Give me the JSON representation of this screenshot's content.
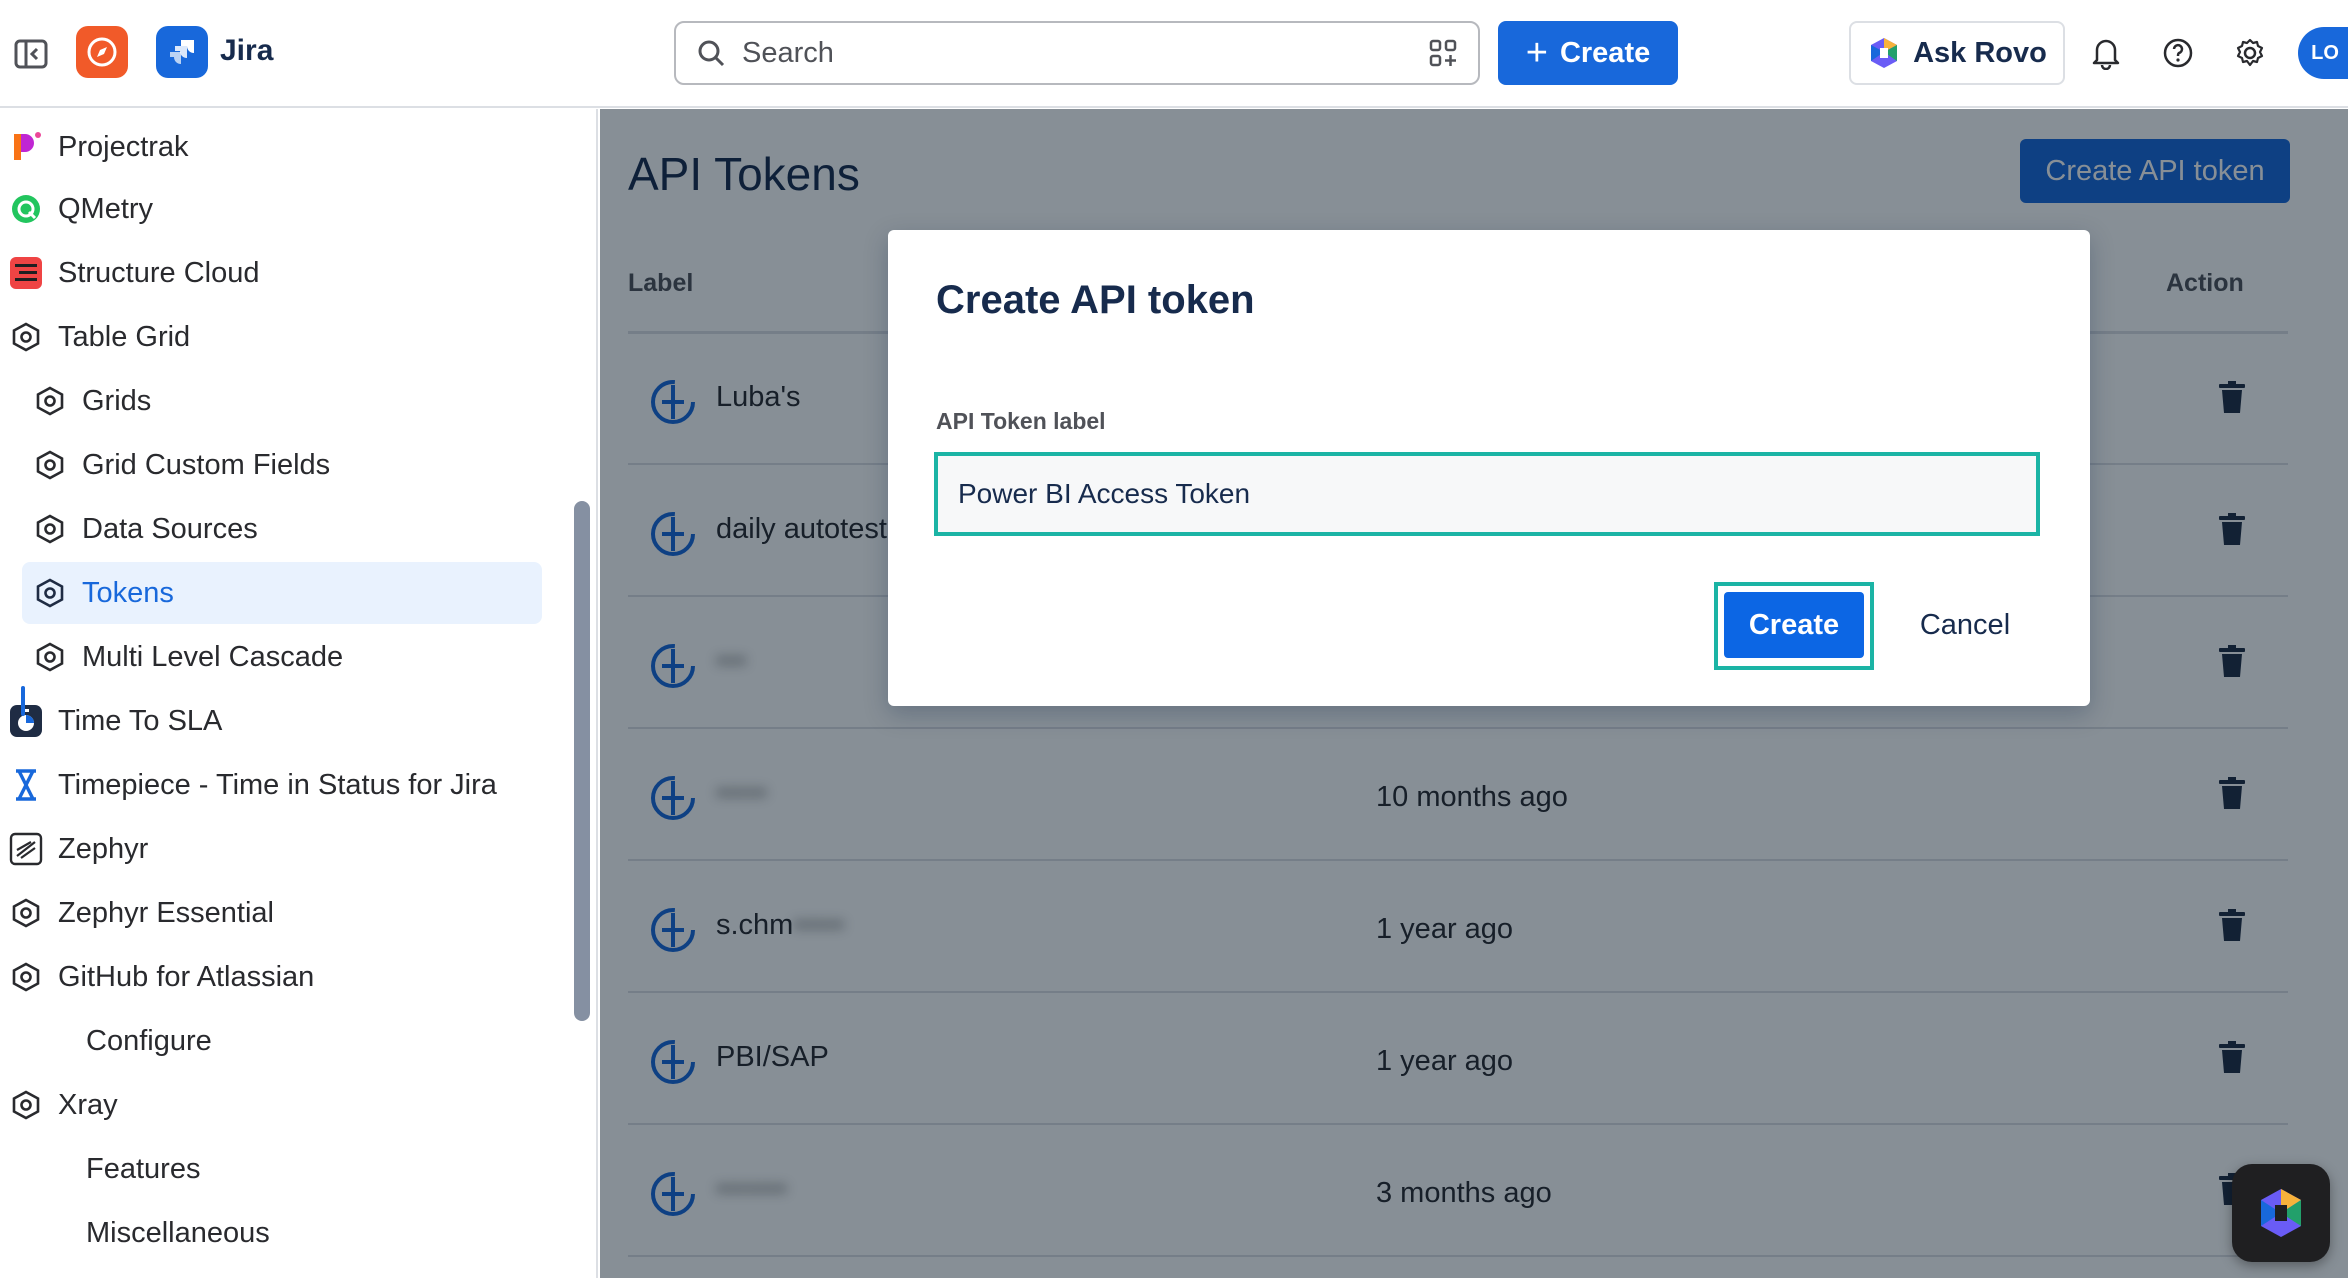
{
  "topbar": {
    "app_name": "Jira",
    "search_placeholder": "Search",
    "create_label": "Create",
    "ask_rovo_label": "Ask Rovo",
    "avatar_initials": "LO"
  },
  "sidebar": {
    "items": [
      {
        "label": "Projectrak",
        "icon": "projectrak-icon"
      },
      {
        "label": "QMetry",
        "icon": "qmetry-icon"
      },
      {
        "label": "Structure Cloud",
        "icon": "structure-icon"
      },
      {
        "label": "Table Grid",
        "icon": "hexagon-icon"
      },
      {
        "label": "Grids",
        "icon": "hexagon-icon"
      },
      {
        "label": "Grid Custom Fields",
        "icon": "hexagon-icon"
      },
      {
        "label": "Data Sources",
        "icon": "hexagon-icon"
      },
      {
        "label": "Tokens",
        "icon": "hexagon-icon",
        "active": true
      },
      {
        "label": "Multi Level Cascade",
        "icon": "hexagon-icon"
      },
      {
        "label": "Time To SLA",
        "icon": "time-to-sla-icon"
      },
      {
        "label": "Timepiece - Time in Status for Jira",
        "icon": "hourglass-icon"
      },
      {
        "label": "Zephyr",
        "icon": "zephyr-icon"
      },
      {
        "label": "Zephyr Essential",
        "icon": "hexagon-icon"
      },
      {
        "label": "GitHub for Atlassian",
        "icon": "hexagon-icon"
      },
      {
        "label": "Configure",
        "icon": ""
      },
      {
        "label": "Xray",
        "icon": "hexagon-icon"
      },
      {
        "label": "Features",
        "icon": ""
      },
      {
        "label": "Miscellaneous",
        "icon": ""
      }
    ]
  },
  "main": {
    "title": "API Tokens",
    "create_token_label": "Create API token",
    "columns": {
      "label": "Label",
      "action": "Action"
    },
    "rows": [
      {
        "label": "Luba's",
        "when": "",
        "blurred": false
      },
      {
        "label": "daily autotest",
        "when": "",
        "blurred": false
      },
      {
        "label": "•••",
        "when": "",
        "blurred": true
      },
      {
        "label": "•••••",
        "when": "10 months ago",
        "blurred": true
      },
      {
        "label": "s.chm",
        "label_blur": "•••••",
        "when": "1 year ago",
        "blurred": false
      },
      {
        "label": "PBI/SAP",
        "when": "1 year ago",
        "blurred": false
      },
      {
        "label": "•••••••",
        "when": "3 months ago",
        "blurred": true
      }
    ]
  },
  "modal": {
    "title": "Create API token",
    "field_label": "API Token label",
    "field_value": "Power BI Access Token",
    "create_label": "Create",
    "cancel_label": "Cancel"
  },
  "colors": {
    "brand_blue": "#1868DB",
    "highlight_teal": "#1BB4A5",
    "overlay": "rgba(5,21,36,0.48)"
  }
}
